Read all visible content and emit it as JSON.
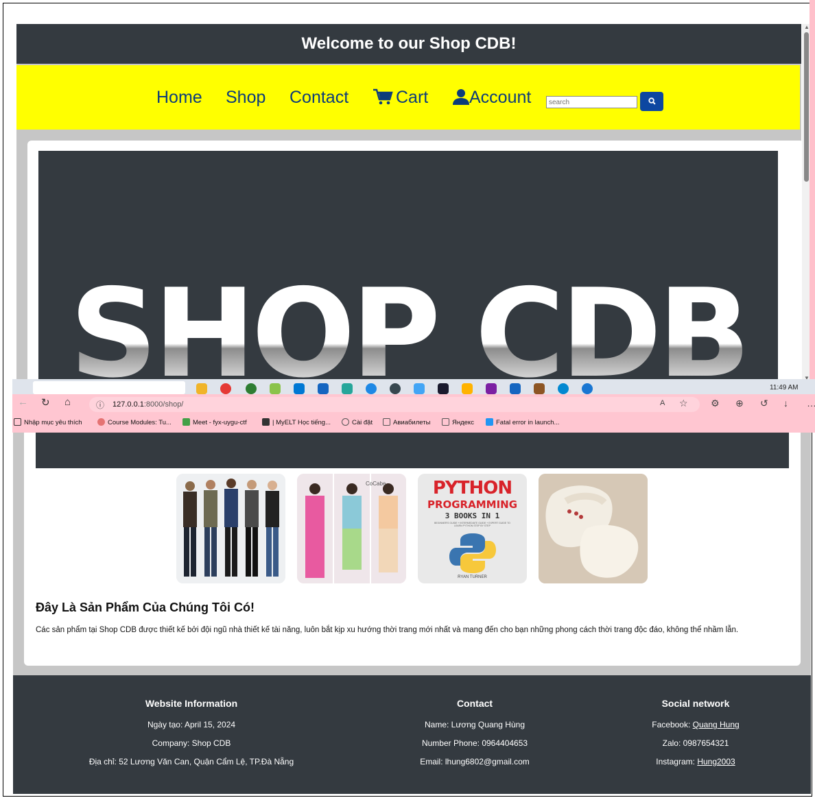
{
  "site": {
    "welcome": "Welcome to our Shop CDB!",
    "nav": {
      "home": "Home",
      "shop": "Shop",
      "contact": "Contact",
      "cart": "Cart",
      "account": "Account"
    },
    "search": {
      "placeholder": "search"
    },
    "banner_text": "SHOP CDB",
    "products": [
      {
        "icon": "menswear-product-image"
      },
      {
        "icon": "pajamas-product-image",
        "label": "CoCabe"
      },
      {
        "icon": "book-product-image",
        "title": "PYTHON",
        "subtitle": "PROGRAMMING",
        "line": "3 BOOKS IN 1",
        "tiny": "BEGINNER'S GUIDE + INTERMEDIATE GUIDE + EXPERT GUIDE TO LEARN PYTHON STEP BY STEP",
        "author": "RYAN TURNER"
      },
      {
        "icon": "slippers-product-image"
      }
    ],
    "heading": "Đây Là Sản Phẩm Của Chúng Tôi Có!",
    "description": "Các sản phẩm tại Shop CDB được thiết kế bởi đội ngũ nhà thiết kế tài năng, luôn bắt kịp xu hướng thời trang mới nhất và mang đến cho bạn những phong cách thời trang độc đáo, không thể nhầm lẫn.",
    "footer": {
      "info": {
        "title": "Website Information",
        "created": "Ngày tạo: April 15, 2024",
        "company": "Company: Shop CDB",
        "address": "Địa chỉ: 52 Lương Văn Can, Quận Cẩm Lệ, TP.Đà Nẵng"
      },
      "contact": {
        "title": "Contact",
        "name": "Name: Lương Quang Hùng",
        "phone": "Number Phone: 0964404653",
        "email": "Email: lhung6802@gmail.com"
      },
      "social": {
        "title": "Social network",
        "facebook_label": "Facebook: ",
        "facebook_link": "Quang Hung",
        "zalo": "Zalo: 0987654321",
        "instagram_label": "Instagram: ",
        "instagram_link": "Hung2003"
      }
    }
  },
  "browser": {
    "url_host": "127.0.0.1",
    "url_path": ":8000/shop/",
    "clock": "11:49 AM",
    "bookmarks": [
      "Nhập mục yêu thích",
      "Course Modules: Tu...",
      "Meet - fyx-uygu-ctf",
      "| MyELT Học tiếng...",
      "Cài đặt",
      "Авиабилеты",
      "Яндекс",
      "Fatal error in launch..."
    ]
  },
  "colors": {
    "dark": "#343a40",
    "nav_yellow": "#ffff00",
    "search_button": "#0d47a1",
    "browser_pink": "#ffc6d1"
  }
}
